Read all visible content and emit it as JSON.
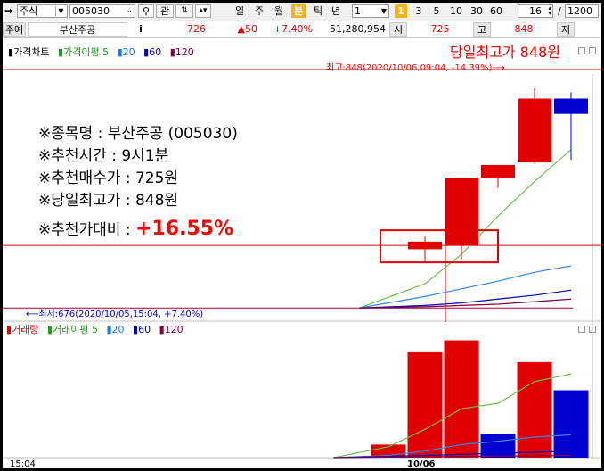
{
  "toolbar": {
    "market_select": "주식",
    "code_value": "005030",
    "search_icon": "magnifier-icon",
    "btn_gwan": "관",
    "btn_rise": "🞀",
    "periods": [
      "일",
      "주",
      "월",
      "분",
      "틱",
      "년"
    ],
    "selected_period": "분",
    "interval_value": "1",
    "interval_marker": "1",
    "interval_options": [
      "3",
      "5",
      "10",
      "30",
      "60"
    ],
    "count_value": "16",
    "count_sep": "/",
    "total_value": "1200"
  },
  "quote": {
    "tag": "주예",
    "name": "부산주공",
    "info_btn": "i",
    "price": "726",
    "change": "▲50",
    "change_pct": "+7.40%",
    "volume": "51,280,954",
    "open_label": "시",
    "open_value": "725",
    "high_label": "고",
    "high_value": "848",
    "low_label": "저"
  },
  "price_panel": {
    "legend": [
      {
        "text": "가격차트",
        "color": "#000000"
      },
      {
        "text": "가격이평 5",
        "color": "#1aa01a"
      },
      {
        "text": "20",
        "color": "#1e78e0"
      },
      {
        "text": "60",
        "color": "#0000c0"
      },
      {
        "text": "120",
        "color": "#800040"
      }
    ],
    "annotation_title": "당일최고가 848원",
    "max_label": "최고:848(2020/10/06,09:04, -14.39%)⟶",
    "min_label": "⟵최저:676(2020/10/05,15:04, +7.40%)",
    "info_lines": [
      "※종목명 : 부산주공 (005030)",
      "※추천시간 : 9시1분",
      "※추천매수가 : 725원",
      "※당일최고가 : 848원"
    ],
    "compare_label": "※추천가대비 :",
    "compare_value": "+16.55%"
  },
  "volume_panel": {
    "legend": [
      {
        "text": "거래량",
        "color": "#e00000"
      },
      {
        "text": "거래이평 5",
        "color": "#1aa01a"
      },
      {
        "text": "20",
        "color": "#1e78e0"
      },
      {
        "text": "60",
        "color": "#0000c0"
      },
      {
        "text": "120",
        "color": "#800040"
      }
    ]
  },
  "axis": {
    "time_left": "15:04",
    "date_label": "10/06"
  },
  "chart_data": {
    "type": "candlestick",
    "colors": {
      "up": "#e00000",
      "down": "#0000d0"
    },
    "candles": [
      {
        "o": 722,
        "h": 732,
        "l": 712,
        "c": 728,
        "dir": "up"
      },
      {
        "o": 725,
        "h": 730,
        "l": 714,
        "c": 778,
        "dir": "up"
      },
      {
        "o": 778,
        "h": 785,
        "l": 770,
        "c": 788,
        "dir": "up"
      },
      {
        "o": 790,
        "h": 848,
        "l": 789,
        "c": 840,
        "dir": "up"
      },
      {
        "o": 840,
        "h": 845,
        "l": 792,
        "c": 828,
        "dir": "down"
      }
    ],
    "price_range": [
      672,
      862
    ],
    "recommend_price": 725,
    "ma": [
      {
        "name": "5",
        "color": "#6cc04a",
        "points": [
          [
            -1.8,
            676
          ],
          [
            0,
            695
          ],
          [
            1,
            718
          ],
          [
            2,
            748
          ],
          [
            3,
            775
          ],
          [
            4,
            800
          ]
        ]
      },
      {
        "name": "20",
        "color": "#3388e6",
        "points": [
          [
            -1.8,
            676
          ],
          [
            0,
            685
          ],
          [
            1,
            691
          ],
          [
            2,
            697
          ],
          [
            3,
            704
          ],
          [
            4,
            709
          ]
        ]
      },
      {
        "name": "60",
        "color": "#0000c0",
        "points": [
          [
            -1.8,
            676
          ],
          [
            0,
            678
          ],
          [
            1,
            680
          ],
          [
            2,
            683
          ],
          [
            3,
            686
          ],
          [
            4,
            690
          ]
        ]
      },
      {
        "name": "120",
        "color": "#800040",
        "points": [
          [
            -1.8,
            676
          ],
          [
            0,
            677
          ],
          [
            1,
            678
          ],
          [
            2,
            679
          ],
          [
            3,
            681
          ],
          [
            4,
            683
          ]
        ]
      }
    ],
    "volume": [
      {
        "v": 0.12,
        "dir": "up"
      },
      {
        "v": 0.97,
        "dir": "up"
      },
      {
        "v": 1.08,
        "dir": "up"
      },
      {
        "v": 0.22,
        "dir": "down"
      },
      {
        "v": 0.88,
        "dir": "up"
      },
      {
        "v": 0.62,
        "dir": "down"
      }
    ],
    "volume_range": [
      0,
      1.15
    ],
    "volume_ma": [
      {
        "name": "5",
        "color": "#6cc04a",
        "points": [
          [
            -1.5,
            0.0
          ],
          [
            0,
            0.1
          ],
          [
            1,
            0.26
          ],
          [
            2,
            0.45
          ],
          [
            3,
            0.5
          ],
          [
            4,
            0.7
          ],
          [
            5,
            0.77
          ]
        ]
      },
      {
        "name": "20",
        "color": "#3388e6",
        "points": [
          [
            -1.5,
            0.0
          ],
          [
            0,
            0.02
          ],
          [
            1,
            0.06
          ],
          [
            2,
            0.12
          ],
          [
            3,
            0.15
          ],
          [
            4,
            0.19
          ],
          [
            5,
            0.21
          ]
        ]
      },
      {
        "name": "60",
        "color": "#0000c0",
        "points": [
          [
            -1.5,
            0.0
          ],
          [
            1,
            0.02
          ],
          [
            3,
            0.04
          ],
          [
            5,
            0.06
          ]
        ]
      },
      {
        "name": "120",
        "color": "#800040",
        "points": [
          [
            -1.5,
            0.0
          ],
          [
            5,
            0.02
          ]
        ]
      }
    ]
  }
}
